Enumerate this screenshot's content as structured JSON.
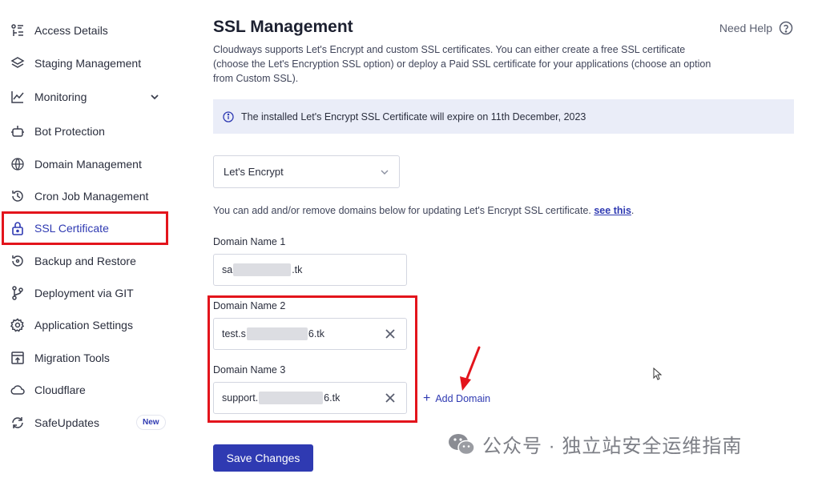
{
  "sidebar": {
    "items": [
      {
        "label": "Access Details",
        "icon": "access-details-icon"
      },
      {
        "label": "Staging Management",
        "icon": "staging-icon"
      },
      {
        "label": "Monitoring",
        "icon": "monitoring-icon"
      },
      {
        "label": "Bot Protection",
        "icon": "bot-icon"
      },
      {
        "label": "Domain Management",
        "icon": "www-icon"
      },
      {
        "label": "Cron Job Management",
        "icon": "clock-history-icon"
      },
      {
        "label": "SSL Certificate",
        "icon": "lock-icon"
      },
      {
        "label": "Backup and Restore",
        "icon": "backup-icon"
      },
      {
        "label": "Deployment via GIT",
        "icon": "git-branch-icon"
      },
      {
        "label": "Application Settings",
        "icon": "gear-icon"
      },
      {
        "label": "Migration Tools",
        "icon": "migration-icon"
      },
      {
        "label": "Cloudflare",
        "icon": "cloud-icon"
      },
      {
        "label": "SafeUpdates",
        "icon": "refresh-icon",
        "badge": "New"
      }
    ],
    "active": "SSL Certificate"
  },
  "main": {
    "title": "SSL Management",
    "help_label": "Need Help",
    "description": "Cloudways supports Let's Encrypt and custom SSL certificates. You can either create a free SSL certificate (choose the Let's Encryption SSL option) or deploy a Paid SSL certificate for your applications (choose an option from Custom SSL).",
    "notice": "The installed Let's Encrypt SSL Certificate will expire on 11th December, 2023",
    "ssl_type_selected": "Let's Encrypt",
    "hint_text": "You can add and/or remove domains below for updating Let's Encrypt SSL certificate.",
    "hint_link": "see this",
    "hint_end": ".",
    "domains": [
      {
        "label": "Domain Name 1",
        "prefix": "sa",
        "suffix": ".tk"
      },
      {
        "label": "Domain Name 2",
        "prefix": "test.s",
        "suffix": "6.tk"
      },
      {
        "label": "Domain Name 3",
        "prefix": "support.",
        "suffix": "6.tk"
      }
    ],
    "add_domain_label": "Add Domain",
    "save_label": "Save Changes"
  },
  "watermark": "公众号 · 独立站安全运维指南",
  "colors": {
    "accent": "#2f3ab2",
    "highlight": "#e3141c",
    "notice_bg": "#eaedf8"
  }
}
